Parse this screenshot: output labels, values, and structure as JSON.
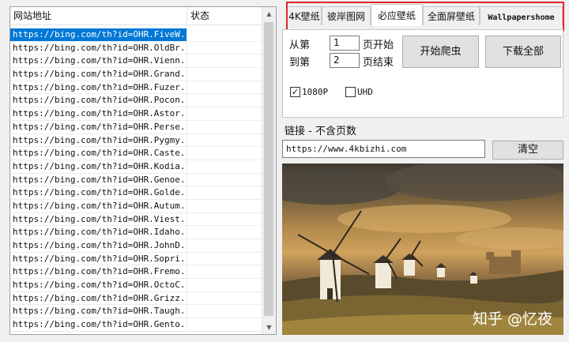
{
  "list": {
    "headers": [
      "网站地址",
      "状态"
    ],
    "rows": [
      {
        "url": "https://bing.com/th?id=OHR.FiveW...",
        "status": ""
      },
      {
        "url": "https://bing.com/th?id=OHR.OldBr...",
        "status": ""
      },
      {
        "url": "https://bing.com/th?id=OHR.Vienn...",
        "status": ""
      },
      {
        "url": "https://bing.com/th?id=OHR.Grand...",
        "status": ""
      },
      {
        "url": "https://bing.com/th?id=OHR.Fuzer...",
        "status": ""
      },
      {
        "url": "https://bing.com/th?id=OHR.Pocon...",
        "status": ""
      },
      {
        "url": "https://bing.com/th?id=OHR.Astor...",
        "status": ""
      },
      {
        "url": "https://bing.com/th?id=OHR.Perse...",
        "status": ""
      },
      {
        "url": "https://bing.com/th?id=OHR.Pygmy...",
        "status": ""
      },
      {
        "url": "https://bing.com/th?id=OHR.Caste...",
        "status": ""
      },
      {
        "url": "https://bing.com/th?id=OHR.Kodia...",
        "status": ""
      },
      {
        "url": "https://bing.com/th?id=OHR.Genoe...",
        "status": ""
      },
      {
        "url": "https://bing.com/th?id=OHR.Golde...",
        "status": ""
      },
      {
        "url": "https://bing.com/th?id=OHR.Autum...",
        "status": ""
      },
      {
        "url": "https://bing.com/th?id=OHR.Viest...",
        "status": ""
      },
      {
        "url": "https://bing.com/th?id=OHR.Idaho...",
        "status": ""
      },
      {
        "url": "https://bing.com/th?id=OHR.JohnD...",
        "status": ""
      },
      {
        "url": "https://bing.com/th?id=OHR.Sopri...",
        "status": ""
      },
      {
        "url": "https://bing.com/th?id=OHR.Fremo...",
        "status": ""
      },
      {
        "url": "https://bing.com/th?id=OHR.OctoC...",
        "status": ""
      },
      {
        "url": "https://bing.com/th?id=OHR.Grizz...",
        "status": ""
      },
      {
        "url": "https://bing.com/th?id=OHR.Taugh...",
        "status": ""
      },
      {
        "url": "https://bing.com/th?id=OHR.Gento...",
        "status": ""
      }
    ],
    "selected_index": 0
  },
  "tabs": [
    "4K壁纸",
    "彼岸图网",
    "必应壁纸",
    "全面屏壁纸",
    "Wallpapershome"
  ],
  "active_tab": 2,
  "controls": {
    "from_label": "从第",
    "from_value": "1",
    "from_suffix": "页开始",
    "to_label": "到第",
    "to_value": "2",
    "to_suffix": "页结束",
    "start_button": "开始爬虫",
    "download_button": "下载全部",
    "checkbox_1080": {
      "label": "1080P",
      "checked": true
    },
    "checkbox_uhd": {
      "label": "UHD",
      "checked": false
    }
  },
  "link": {
    "heading": "链接 - 不含页数",
    "url": "https://www.4kbizhi.com",
    "clear_button": "清空"
  },
  "preview": {
    "watermark": "知乎 @忆夜"
  },
  "colors": {
    "selection": "#0078d7",
    "highlight_border": "#e0262b"
  }
}
